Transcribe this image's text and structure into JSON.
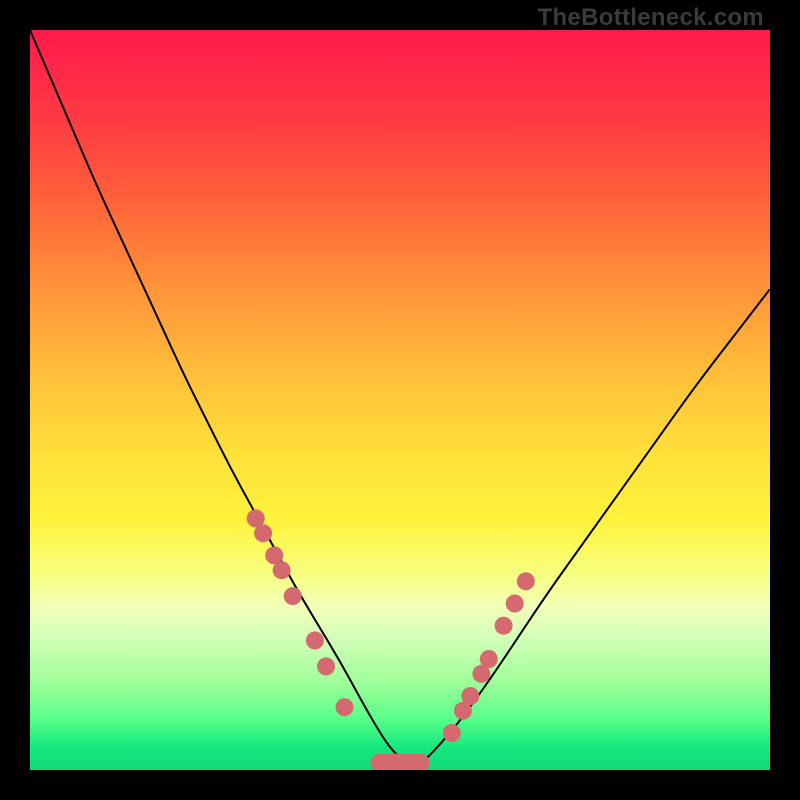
{
  "watermark": "TheBottleneck.com",
  "chart_data": {
    "type": "line",
    "title": "",
    "xlabel": "",
    "ylabel": "",
    "xlim": [
      0,
      100
    ],
    "ylim": [
      0,
      100
    ],
    "grid": false,
    "legend": false,
    "curve_samples": {
      "x": [
        0,
        3,
        6,
        9,
        12,
        15,
        18,
        21,
        24,
        27,
        30,
        33,
        36,
        39,
        42,
        45,
        47,
        49,
        51,
        53,
        55,
        58,
        62,
        66,
        70,
        75,
        80,
        85,
        90,
        95,
        100
      ],
      "y": [
        100,
        93,
        86,
        79,
        72.5,
        66,
        59.5,
        53,
        47,
        41,
        35.5,
        30,
        24.5,
        19.5,
        14.5,
        9,
        5.5,
        2.5,
        1,
        1,
        3,
        6.5,
        12,
        18,
        24,
        31,
        38,
        45,
        52,
        58.5,
        65
      ]
    },
    "markers_left": {
      "x": [
        30.5,
        31.5,
        33,
        34,
        35.5,
        38.5,
        40,
        42.5
      ],
      "y": [
        34,
        32,
        29,
        27,
        23.5,
        17.5,
        14,
        8.5
      ]
    },
    "markers_right": {
      "x": [
        57,
        58.5,
        59.5,
        61,
        62,
        64,
        65.5,
        67
      ],
      "y": [
        5,
        8,
        10,
        13,
        15,
        19.5,
        22.5,
        25.5
      ]
    },
    "flat_segment": {
      "x_start": 46,
      "x_end": 54,
      "y": 1
    }
  },
  "colors": {
    "marker": "#d46a6f",
    "curve": "#000000",
    "frame": "#000000"
  }
}
